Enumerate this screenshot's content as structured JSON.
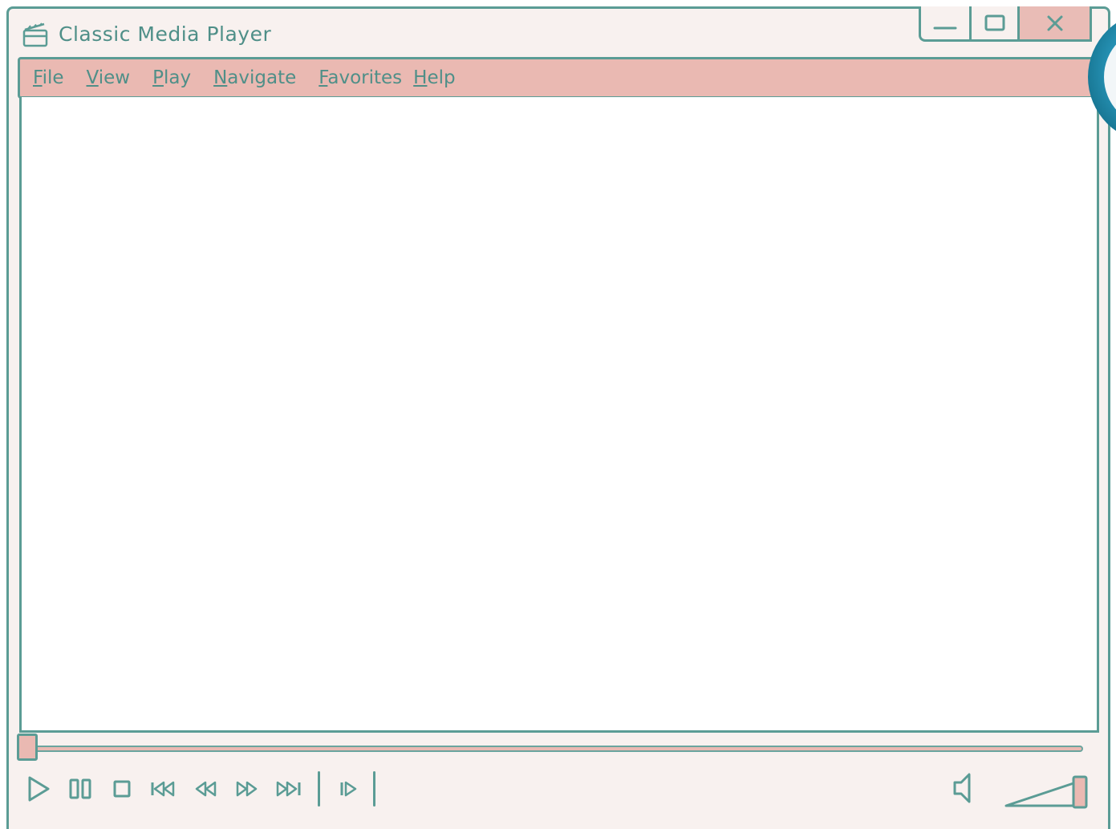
{
  "window": {
    "title": "Classic Media Player"
  },
  "menu": [
    {
      "accel": "F",
      "rest": "ile"
    },
    {
      "accel": "V",
      "rest": "iew"
    },
    {
      "accel": "P",
      "rest": "lay"
    },
    {
      "accel": "N",
      "rest": "avigate"
    },
    {
      "accel": "F",
      "rest": "avorites"
    },
    {
      "accel": "H",
      "rest": "elp"
    }
  ],
  "playback": {
    "seek_position": 0,
    "volume_level": 1.0
  },
  "icons": {
    "app": "media-player-icon",
    "minimize": "minimize-icon",
    "maximize": "maximize-icon",
    "close": "close-icon",
    "play": "play-icon",
    "pause": "pause-icon",
    "stop": "stop-icon",
    "skip_back": "skip-back-icon",
    "rewind": "rewind-icon",
    "fast_forward": "fast-forward-icon",
    "skip_forward": "skip-forward-icon",
    "frame_step": "frame-step-icon",
    "volume": "volume-icon"
  },
  "colors": {
    "accent": "#5b9c95",
    "menubar": "#eab9b2",
    "frame": "#f8f1ef",
    "orb": "#2b9bc0"
  }
}
